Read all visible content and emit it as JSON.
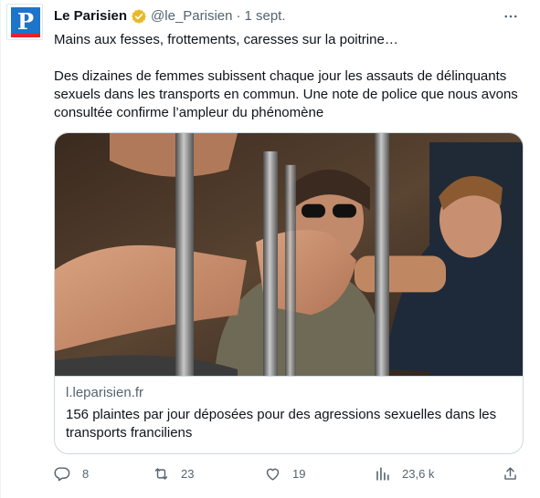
{
  "tweet": {
    "author_name": "Le Parisien",
    "author_handle": "@le_Parisien",
    "separator": "·",
    "date": "1 sept.",
    "avatar_letter": "P",
    "text_line1": "Mains aux fesses, frottements, caresses sur la poitrine…",
    "text_line2": "Des dizaines de femmes subissent chaque jour les assauts de délinquants sexuels dans les transports en commun. Une note de police que nous avons consultée confirme l’ampleur du phénomène"
  },
  "card": {
    "domain": "l.leparisien.fr",
    "title": "156 plaintes par jour déposées pour des agressions sexuelles dans les transports franciliens"
  },
  "actions": {
    "replies": "8",
    "retweets": "23",
    "likes": "19",
    "views": "23,6 k"
  },
  "icons": {
    "more": "more-icon",
    "verified": "verified-badge-icon",
    "reply": "reply-icon",
    "retweet": "retweet-icon",
    "like": "heart-icon",
    "views": "views-icon",
    "share": "share-icon"
  },
  "colors": {
    "text": "#0f1419",
    "secondary": "#536471",
    "border": "#cfd9de",
    "brand_blue": "#1d74c8",
    "brand_red": "#e2222e",
    "verified_gold": "#e8b829"
  }
}
